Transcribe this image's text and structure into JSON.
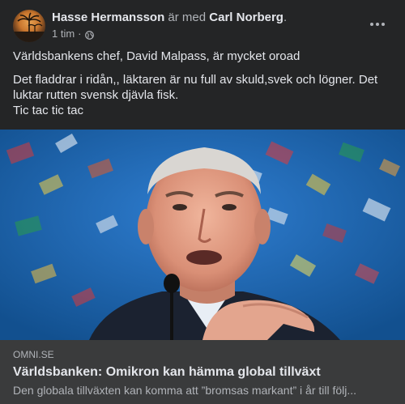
{
  "post": {
    "author": "Hasse Hermansson",
    "with_text": "är med",
    "tagged": "Carl Norberg",
    "period": ".",
    "time": "1 tim",
    "separator": "·",
    "privacy_icon": "globe-icon",
    "more_icon": "more-options-icon",
    "lines": [
      "Världsbankens chef, David Malpass, är mycket oroad",
      "Det fladdrar i ridån,, läktaren är nu full av skuld,svek och lögner. Det luktar rutten svensk djävla fisk.",
      "Tic tac tic tac"
    ]
  },
  "link": {
    "domain": "OMNI.SE",
    "title": "Världsbanken: Omikron kan hämma global tillväxt",
    "description": "Den globala tillväxten kan komma att ”bromsas markant” i år till följ..."
  },
  "colors": {
    "card_bg": "#242526",
    "link_card_bg": "#3a3b3c",
    "text_primary": "#e4e6eb",
    "text_secondary": "#b0b3b8"
  }
}
